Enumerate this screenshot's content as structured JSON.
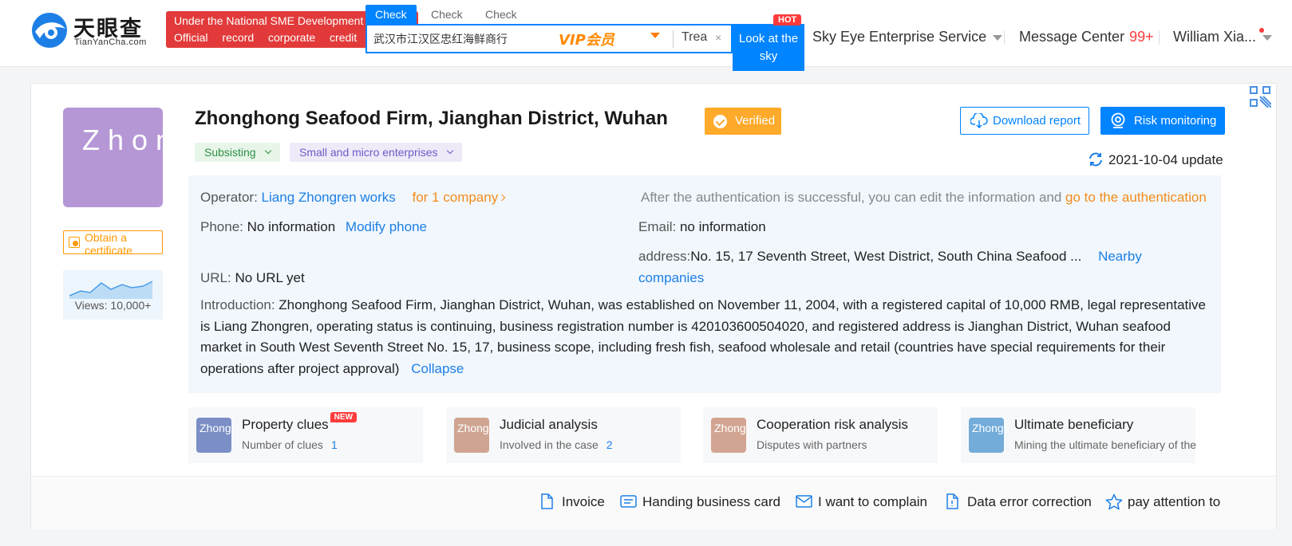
{
  "header": {
    "logo_cn": "天眼查",
    "logo_en": "TianYanCha.com",
    "banner_line1": "Under the National SME Development Fund",
    "banner_line2": "Official record corporate credit",
    "search_tabs": [
      "Check",
      "Check",
      "Check"
    ],
    "search_value": "武汉市江汉区忠红海鲜商行",
    "vip_label": "VIP会员",
    "search_hint": "Trea",
    "clear_symbol": "×",
    "search_button": "Look at the sky",
    "hot_badge": "HOT",
    "nav_enterprise": "Sky Eye Enterprise Service",
    "nav_message": "Message Center",
    "message_count": "99+",
    "nav_user": "William Xia..."
  },
  "company": {
    "avatar_text": "Zhong Seafood",
    "name": "Zhonghong Seafood Firm, Jianghan District, Wuhan",
    "verified": "Verified",
    "tags": [
      "Subsisting",
      "Small and micro enterprises"
    ],
    "obtain_certificate": "Obtain a certificate",
    "views": "Views: 10,000+",
    "download_report": "Download report",
    "risk_monitoring": "Risk monitoring",
    "update": "2021-10-04 update"
  },
  "info": {
    "operator_label": "Operator:",
    "operator_name": "Liang Zhongren works",
    "operator_companies": "for 1 company",
    "auth_note": "After the authentication is successful, you can edit the information and",
    "auth_link": "go to the authentication",
    "phone_label": "Phone:",
    "phone_value": "No information",
    "modify_phone": "Modify phone",
    "email_label": "Email:",
    "email_value": "no information",
    "address_label": "address:",
    "address_value": "No. 15, 17 Seventh Street, West District, South China Seafood ...",
    "nearby_link_1": "Nearby",
    "nearby_link_2": "companies",
    "url_label": "URL:",
    "url_value": "No URL yet",
    "intro_label": "Introduction:",
    "intro_text": "Zhonghong Seafood Firm, Jianghan District, Wuhan, was established on November 11, 2004, with a registered capital of 10,000 RMB, legal representative is Liang Zhongren, operating status is continuing, business registration number is 420103600504020, and registered address is Jianghan District, Wuhan seafood market in South West Seventh Street No. 15, 17, business scope, including fresh fish, seafood wholesale and retail (countries have special requirements for their operations after project approval)",
    "collapse": "Collapse"
  },
  "features": [
    {
      "icon_text": "Zhong Seafood",
      "title": "Property clues",
      "badge": "NEW",
      "sub": "Number of clues",
      "num": "1",
      "color": "#7b8fc6"
    },
    {
      "icon_text": "Zhong Seafood",
      "title": "Judicial analysis",
      "badge": "",
      "sub": "Involved in the case",
      "num": "2",
      "color": "#cfa592"
    },
    {
      "icon_text": "Zhong Seafood",
      "title": "Cooperation risk analysis",
      "badge": "",
      "sub": "Disputes with partners",
      "num": "",
      "color": "#d2a592"
    },
    {
      "icon_text": "Zhong Seafood",
      "title": "Ultimate beneficiary",
      "badge": "",
      "sub": "Mining the ultimate beneficiary of the company",
      "num": "",
      "color": "#73acd9"
    }
  ],
  "footer_actions": [
    "Invoice",
    "Handing business card",
    "I want to complain",
    "Data error correction",
    "pay attention to"
  ],
  "colors": {
    "primary": "#0084ff",
    "accent_orange": "#ffaa2a",
    "link_blue": "#1e7fe6",
    "banner_red": "#e23a3a"
  }
}
